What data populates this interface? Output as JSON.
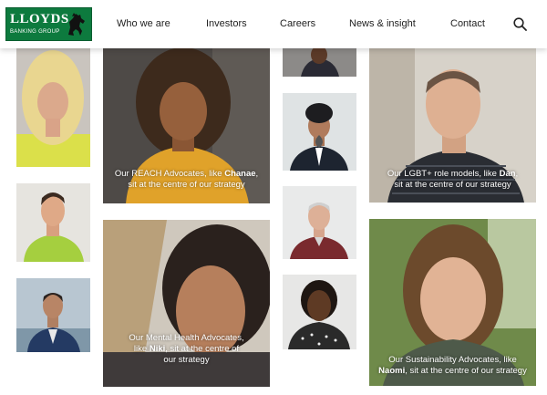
{
  "brand": {
    "name": "LLOYDS",
    "sub": "BANKING GROUP",
    "green": "#0d7a3e"
  },
  "nav": {
    "items": [
      "Who we are",
      "Investors",
      "Careers",
      "News & insight",
      "Contact"
    ],
    "search_icon": "search-icon"
  },
  "tiles": {
    "chanae": {
      "pre": "Our REACH Advocates, like ",
      "name": "Chanae",
      "post": ",",
      "line2": "sit at the centre of our strategy"
    },
    "dan": {
      "pre": "Our LGBT+ role models, like ",
      "name": "Dan",
      "post": ",",
      "line2": "sit at the centre of our strategy"
    },
    "niki": {
      "line1": "Our Mental Health Advocates,",
      "pre": "like ",
      "name": "Niki",
      "post": ", sit at the centre of",
      "line3": "our strategy"
    },
    "naomi": {
      "line1": "Our Sustainability Advocates, like",
      "name": "Naomi",
      "post": ", sit at the centre of our strategy"
    }
  }
}
